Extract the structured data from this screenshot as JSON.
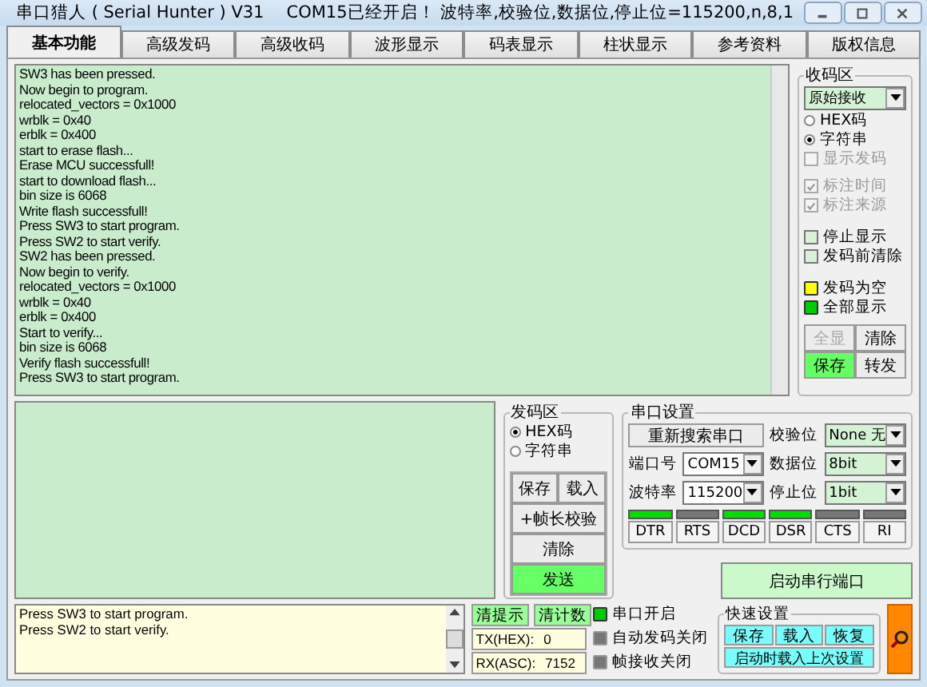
{
  "window": {
    "title": "串口猎人 ( Serial Hunter ) V31",
    "status": "COM15已经开启！ 波特率,校验位,数据位,停止位=115200,n,8,1"
  },
  "tabs": [
    {
      "label": "基本功能",
      "selected": true
    },
    {
      "label": "高级发码",
      "selected": false
    },
    {
      "label": "高级收码",
      "selected": false
    },
    {
      "label": "波形显示",
      "selected": false
    },
    {
      "label": "码表显示",
      "selected": false
    },
    {
      "label": "柱状显示",
      "selected": false
    },
    {
      "label": "参考资料",
      "selected": false
    },
    {
      "label": "版权信息",
      "selected": false
    }
  ],
  "receive_log": [
    "SW3 has been pressed.",
    "Now begin to program.",
    "relocated_vectors = 0x1000",
    "wrblk = 0x40",
    "erblk = 0x400",
    "start to erase flash...",
    "Erase MCU successfull!",
    "start to download flash...",
    "bin size is 6068",
    "Write flash successfull!",
    "Press SW3 to start program.",
    "Press SW2 to start verify.",
    "SW2 has been pressed.",
    "Now begin to verify.",
    "relocated_vectors = 0x1000",
    "wrblk = 0x40",
    "erblk = 0x400",
    "Start to verify...",
    "bin size is 6068",
    "Verify flash successfull!",
    "Press SW3 to start program."
  ],
  "receive_panel": {
    "title": "收码区",
    "mode": "原始接收",
    "radios": [
      {
        "label": "HEX码",
        "selected": false
      },
      {
        "label": "字符串",
        "selected": true
      }
    ],
    "checkboxes": [
      {
        "label": "显示发码",
        "checked": false,
        "disabled": true
      },
      {
        "label": "标注时间",
        "checked": true,
        "disabled": true
      },
      {
        "label": "标注来源",
        "checked": true,
        "disabled": true
      },
      {
        "label": "停止显示",
        "checked": false,
        "disabled": false
      },
      {
        "label": "发码前清除",
        "checked": false,
        "disabled": false
      }
    ],
    "indicators": [
      {
        "label": "发码为空",
        "color": "#ffff00"
      },
      {
        "label": "全部显示",
        "color": "#00cc00"
      }
    ],
    "buttons": [
      {
        "label": "全显",
        "disabled": true,
        "highlighted": false
      },
      {
        "label": "清除",
        "disabled": false,
        "highlighted": false
      },
      {
        "label": "保存",
        "disabled": false,
        "highlighted": true
      },
      {
        "label": "转发",
        "disabled": false,
        "highlighted": false
      }
    ]
  },
  "send_panel": {
    "title": "发码区",
    "radios": [
      {
        "label": "HEX码",
        "selected": true
      },
      {
        "label": "字符串",
        "selected": false
      }
    ],
    "button_rows": [
      [
        {
          "label": "保存",
          "highlighted": false
        },
        {
          "label": "载入",
          "highlighted": false
        }
      ],
      [
        {
          "label": "+帧长校验",
          "highlighted": false
        }
      ],
      [
        {
          "label": "清除",
          "highlighted": false
        }
      ],
      [
        {
          "label": "发送",
          "highlighted": true
        }
      ]
    ]
  },
  "serial_settings": {
    "title": "串口设置",
    "rescan_button": "重新搜索串口",
    "fields": [
      {
        "label": "校验位",
        "value": "None 无"
      },
      {
        "label": "端口号",
        "value": "COM15"
      },
      {
        "label": "数据位",
        "value": "8bit"
      },
      {
        "label": "波特率",
        "value": "115200"
      },
      {
        "label": "停止位",
        "value": "1bit"
      }
    ],
    "lines": [
      {
        "label": "DTR",
        "on": true
      },
      {
        "label": "RTS",
        "on": false
      },
      {
        "label": "DCD",
        "on": true
      },
      {
        "label": "DSR",
        "on": true
      },
      {
        "label": "CTS",
        "on": false
      },
      {
        "label": "RI",
        "on": false
      }
    ],
    "start_button": "启动串行端口"
  },
  "hint_log": [
    "Press SW3 to start program.",
    "Press SW2 to start verify."
  ],
  "count_buttons": [
    "清提示",
    "清计数"
  ],
  "counters": [
    {
      "label": "TX(HEX):",
      "value": "0"
    },
    {
      "label": "RX(ASC):",
      "value": "7152"
    }
  ],
  "status_leds": [
    {
      "label": "串口开启",
      "on": true
    },
    {
      "label": "自动发码关闭",
      "on": false
    },
    {
      "label": "帧接收关闭",
      "on": false
    }
  ],
  "quick_settings": {
    "title": "快速设置",
    "buttons": [
      "保存",
      "载入",
      "恢复"
    ],
    "wide_button": "启动时载入上次设置"
  }
}
